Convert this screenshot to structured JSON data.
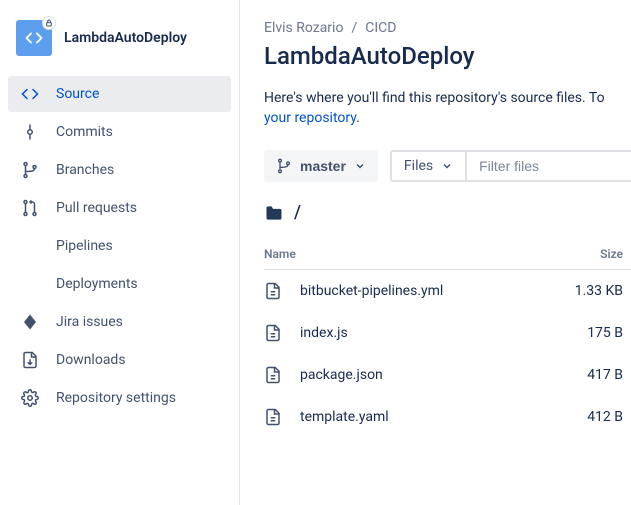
{
  "sidebar": {
    "repo_name": "LambdaAutoDeploy",
    "items": [
      {
        "label": "Source",
        "icon": "code",
        "active": true
      },
      {
        "label": "Commits",
        "icon": "commit",
        "active": false
      },
      {
        "label": "Branches",
        "icon": "branch",
        "active": false
      },
      {
        "label": "Pull requests",
        "icon": "pullrequest",
        "active": false
      },
      {
        "label": "Pipelines",
        "icon": "",
        "active": false
      },
      {
        "label": "Deployments",
        "icon": "",
        "active": false
      },
      {
        "label": "Jira issues",
        "icon": "jira",
        "active": false
      },
      {
        "label": "Downloads",
        "icon": "download",
        "active": false
      },
      {
        "label": "Repository settings",
        "icon": "settings",
        "active": false
      }
    ]
  },
  "breadcrumb": {
    "owner": "Elvis Rozario",
    "project": "CICD"
  },
  "page_title": "LambdaAutoDeploy",
  "description_prefix": "Here's where you'll find this repository's source files. To",
  "description_link": "your repository",
  "description_suffix": ".",
  "branch_selector": {
    "label": "master"
  },
  "filter": {
    "type": "Files",
    "placeholder": "Filter files"
  },
  "path": "/",
  "table": {
    "headers": {
      "name": "Name",
      "size": "Size"
    },
    "rows": [
      {
        "name": "bitbucket-pipelines.yml",
        "size": "1.33 KB"
      },
      {
        "name": "index.js",
        "size": "175 B"
      },
      {
        "name": "package.json",
        "size": "417 B"
      },
      {
        "name": "template.yaml",
        "size": "412 B"
      }
    ]
  }
}
